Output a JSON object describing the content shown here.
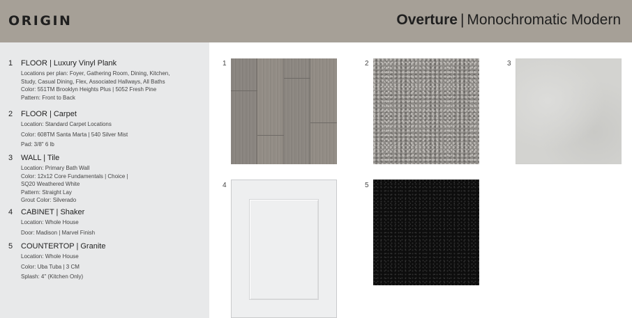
{
  "header": {
    "brand": "ORIGIN",
    "collection_name": "Overture",
    "separator": "|",
    "collection_subtitle": "Monochromatic Modern"
  },
  "specs": [
    {
      "number": "1",
      "heading": "FLOOR | Luxury Vinyl Plank",
      "lines": [
        "Locations per plan: Foyer, Gathering Room, Dining, Kitchen,",
        "Study, Casual Dining, Flex, Associated Hallways,  All Baths",
        "Color: 551TM Brooklyn Heights Plus | 5052 Fresh Pine",
        "Pattern: Front to Back"
      ]
    },
    {
      "number": "2",
      "heading": "FLOOR | Carpet",
      "lines": [
        "Location: Standard Carpet Locations",
        "Color: 608TM Santa Marta | 540 Silver Mist",
        "Pad: 3/8\" 6 lb"
      ]
    },
    {
      "number": "3",
      "heading": "WALL | Tile",
      "lines": [
        "Location: Primary Bath Wall",
        "Color: 12x12 Core Fundamentals | Choice |",
        "SQ20 Weathered White",
        "Pattern: Straight Lay",
        "Grout Color: Silverado"
      ]
    },
    {
      "number": "4",
      "heading": "CABINET | Shaker",
      "lines": [
        "Location: Whole House",
        "Door: Madison | Marvel Finish"
      ]
    },
    {
      "number": "5",
      "heading": "COUNTERTOP | Granite",
      "lines": [
        "Location: Whole House",
        "Color: Uba Tuba | 3 CM",
        "Splash: 4\" (Kitchen Only)"
      ]
    }
  ],
  "swatches": [
    {
      "number": "1"
    },
    {
      "number": "2"
    },
    {
      "number": "3"
    },
    {
      "number": "4"
    },
    {
      "number": "5"
    }
  ]
}
